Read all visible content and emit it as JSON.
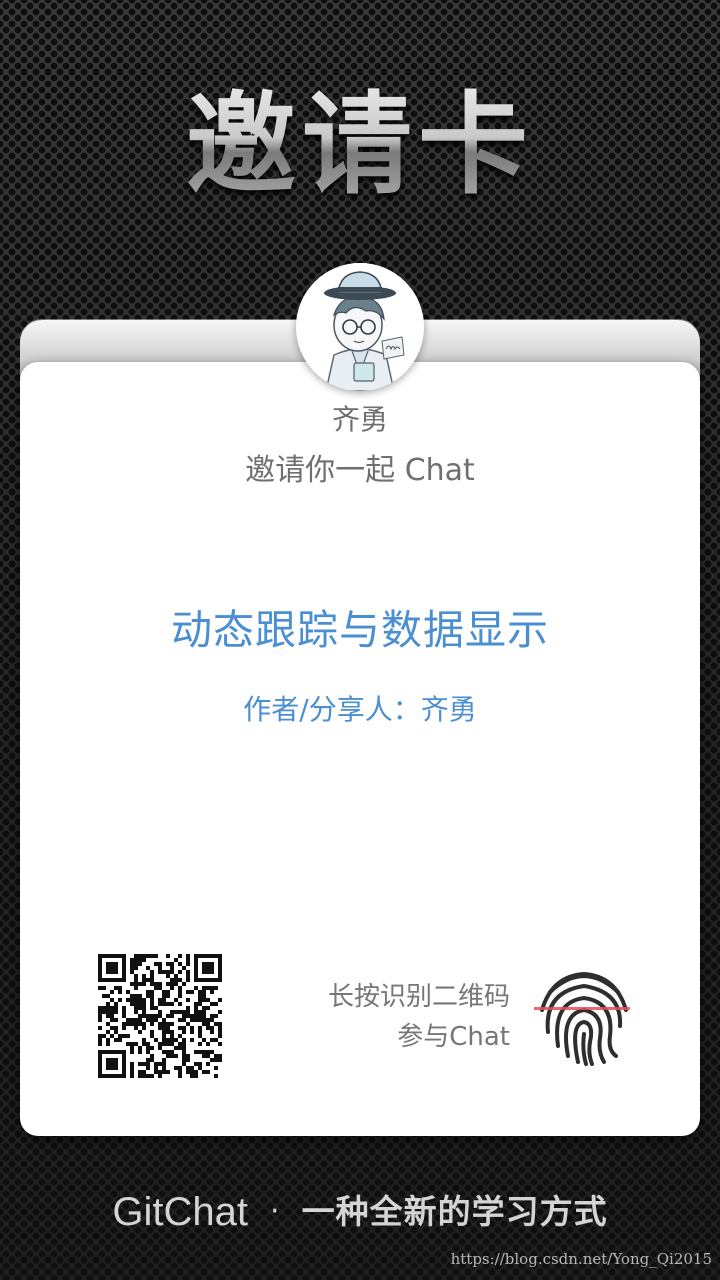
{
  "header": {
    "title": "邀请卡"
  },
  "inviter": {
    "avatar_icon": "avatar-illustration",
    "name": "齐勇",
    "invite_text": "邀请你一起 Chat"
  },
  "chat": {
    "title": "动态跟踪与数据显示",
    "author_line": "作者/分享人：齐勇"
  },
  "join": {
    "qr_icon": "qr-code-icon",
    "hint_line1": "长按识别二维码",
    "hint_line2": "参与Chat",
    "fingerprint_icon": "fingerprint-icon",
    "fingerprint_scan_color": "#e0505a"
  },
  "footer": {
    "brand": "GitChat",
    "separator": "·",
    "slogan": "一种全新的学习方式"
  },
  "watermark": "https://blog.csdn.net/Yong_Qi2015",
  "colors": {
    "accent_blue": "#4a8fd1",
    "card": "#ffffff",
    "muted_text": "#6f6f6f"
  }
}
